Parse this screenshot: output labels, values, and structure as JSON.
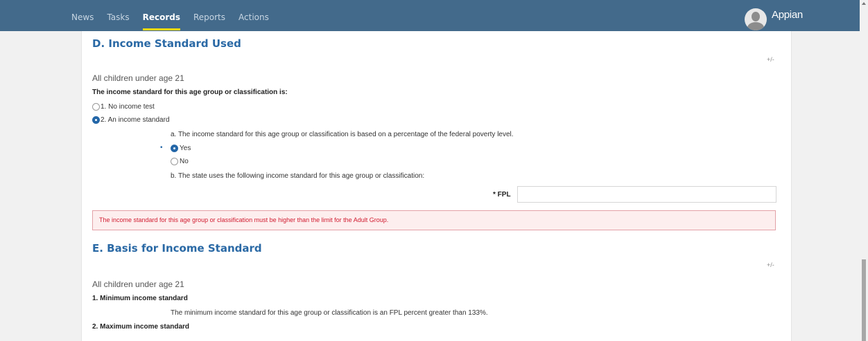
{
  "nav": {
    "items": [
      "News",
      "Tasks",
      "Records",
      "Reports",
      "Actions"
    ],
    "active": "Records",
    "brand": "Appian"
  },
  "section_d": {
    "title": "D. Income Standard Used",
    "toggle": "+/-",
    "group": "All children under age 21",
    "question": "The income standard for this age group or classification is:",
    "options": [
      "1. No income test",
      "2. An income standard"
    ],
    "selected_option": "2. An income standard",
    "sub_a": {
      "text": "a. The income standard for this age group or classification is based on a percentage of the federal poverty level.",
      "required_marker": "•",
      "options": [
        "Yes",
        "No"
      ],
      "selected": "Yes"
    },
    "sub_b": {
      "text": "b. The state uses the following income standard for this age group or classification:",
      "fpl_label": "* FPL",
      "fpl_value": ""
    },
    "error": "The income standard for this age group or classification must be higher than the limit for the Adult Group."
  },
  "section_e": {
    "title": "E. Basis for Income Standard",
    "toggle": "+/-",
    "group": "All children under age 21",
    "min_label": "1. Minimum income standard",
    "min_text": "The minimum income standard for this age group or classification is an FPL percent greater than 133%.",
    "max_label": "2. Maximum income standard"
  },
  "colors": {
    "topbar": "#436a8b",
    "active_underline": "#f5d90a",
    "section_title": "#2a69a5",
    "error_text": "#d11b2f",
    "error_bg": "#fdeeee"
  }
}
